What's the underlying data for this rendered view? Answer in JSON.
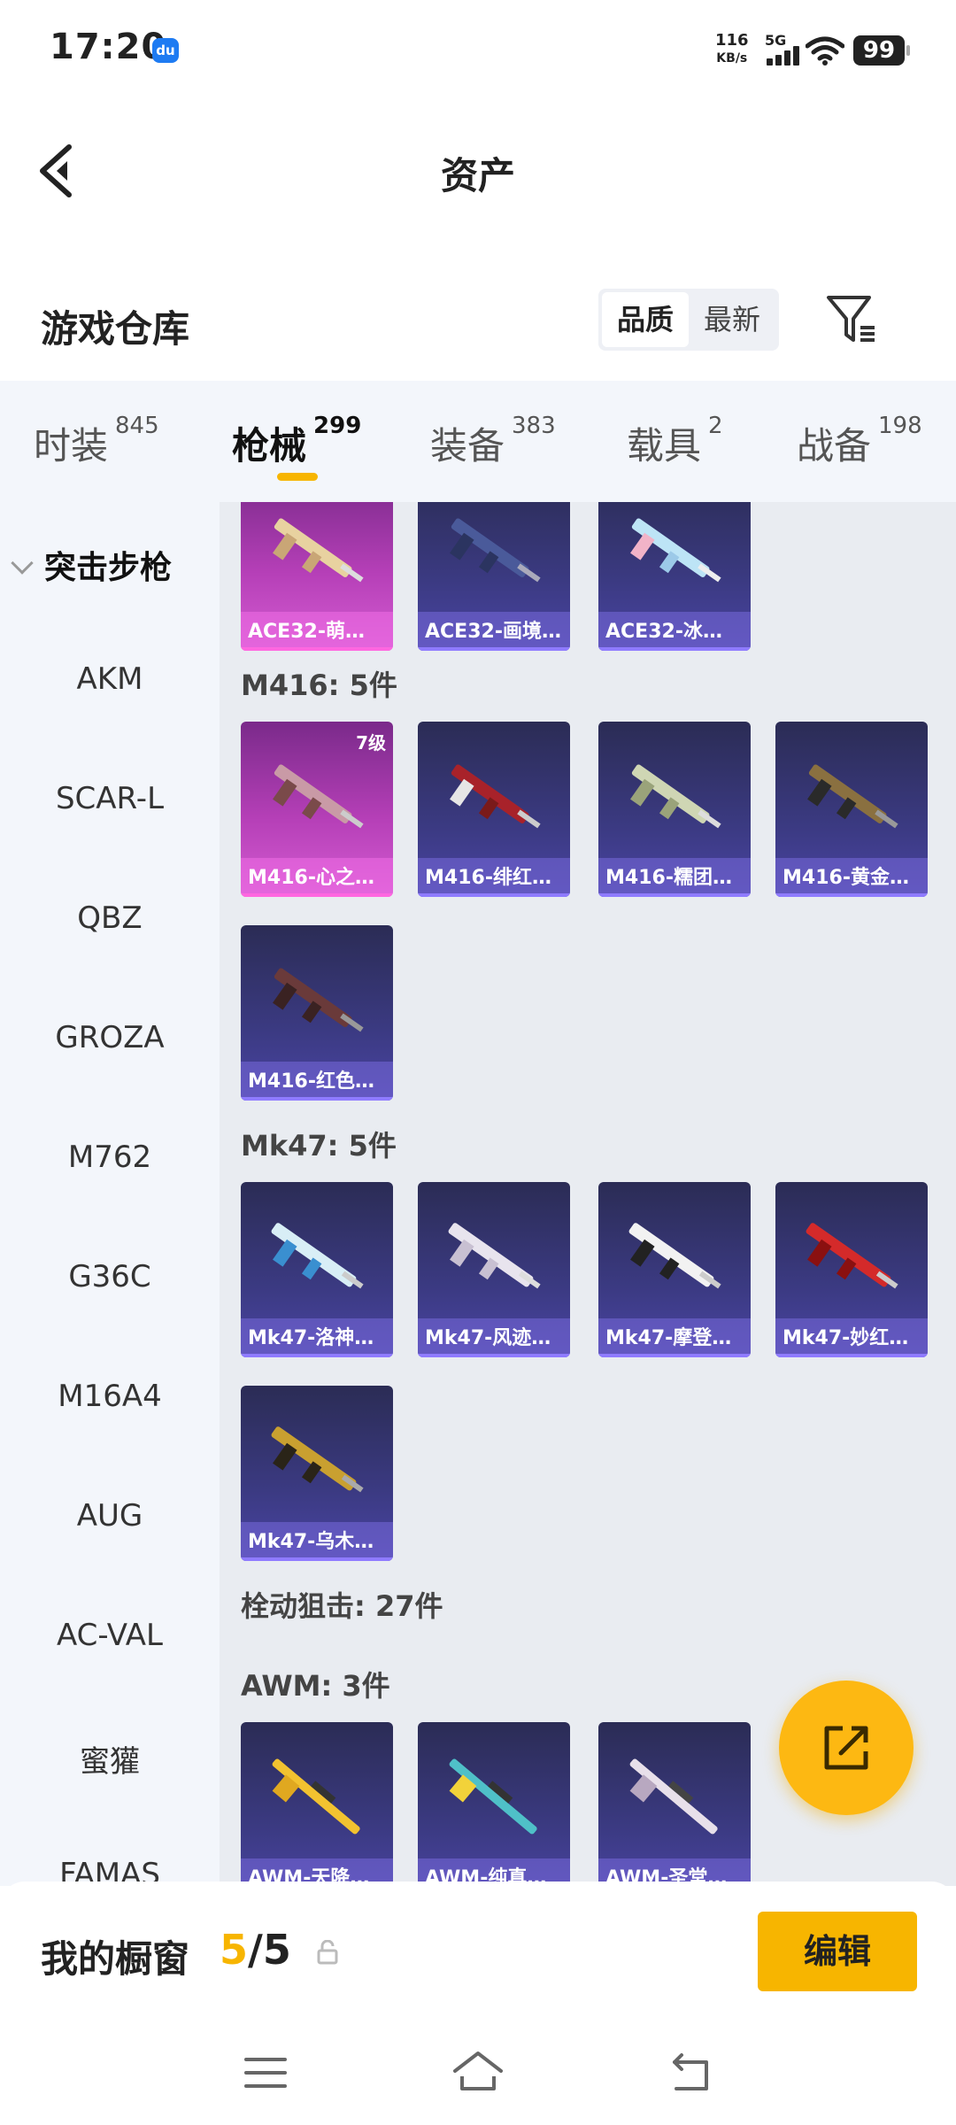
{
  "status": {
    "time": "17:20",
    "app_badge": "du",
    "net_speed_value": "116",
    "net_speed_unit": "KB/s",
    "network": "5G",
    "battery": "99"
  },
  "header": {
    "title": "资产"
  },
  "toolbar": {
    "title": "游戏仓库",
    "sort_quality": "品质",
    "sort_newest": "最新"
  },
  "tabs": [
    {
      "label": "时装",
      "count": "845"
    },
    {
      "label": "枪械",
      "count": "299",
      "active": true
    },
    {
      "label": "装备",
      "count": "383"
    },
    {
      "label": "载具",
      "count": "2"
    },
    {
      "label": "战备",
      "count": "198"
    }
  ],
  "sidebar": {
    "category": "突击步枪",
    "items": [
      "AKM",
      "SCAR-L",
      "QBZ",
      "GROZA",
      "M762",
      "G36C",
      "M16A4",
      "AUG",
      "AC-VAL",
      "蜜獾",
      "FAMAS"
    ]
  },
  "groups": {
    "ace32": {
      "cards": [
        "ACE32-萌…",
        "ACE32-画境…",
        "ACE32-冰…"
      ]
    },
    "m416": {
      "title": "M416: 5件",
      "cards": [
        "M416-心之…",
        "M416-绯红…",
        "M416-糯团…",
        "M416-黄金…",
        "M416-红色…"
      ],
      "level": "7级"
    },
    "mk47": {
      "title": "Mk47: 5件",
      "cards": [
        "Mk47-洛神…",
        "Mk47-风迹…",
        "Mk47-摩登…",
        "Mk47-妙红…",
        "Mk47-乌木…"
      ]
    },
    "bolt": {
      "title": "栓动狙击: 27件"
    },
    "awm": {
      "title": "AWM: 3件",
      "cards": [
        "AWM-天降…",
        "AWM-纯真…",
        "AWM-圣堂…"
      ]
    }
  },
  "showcase": {
    "label": "我的橱窗",
    "current": "5",
    "total": "/5",
    "edit": "编辑"
  },
  "colors": {
    "accent": "#f7b500",
    "card_purple": "#3b3a82",
    "card_pink": "#b53fb7"
  },
  "icons": [
    "back-icon",
    "filter-icon",
    "share-icon",
    "lock-icon",
    "menu-icon",
    "home-icon",
    "return-icon"
  ]
}
